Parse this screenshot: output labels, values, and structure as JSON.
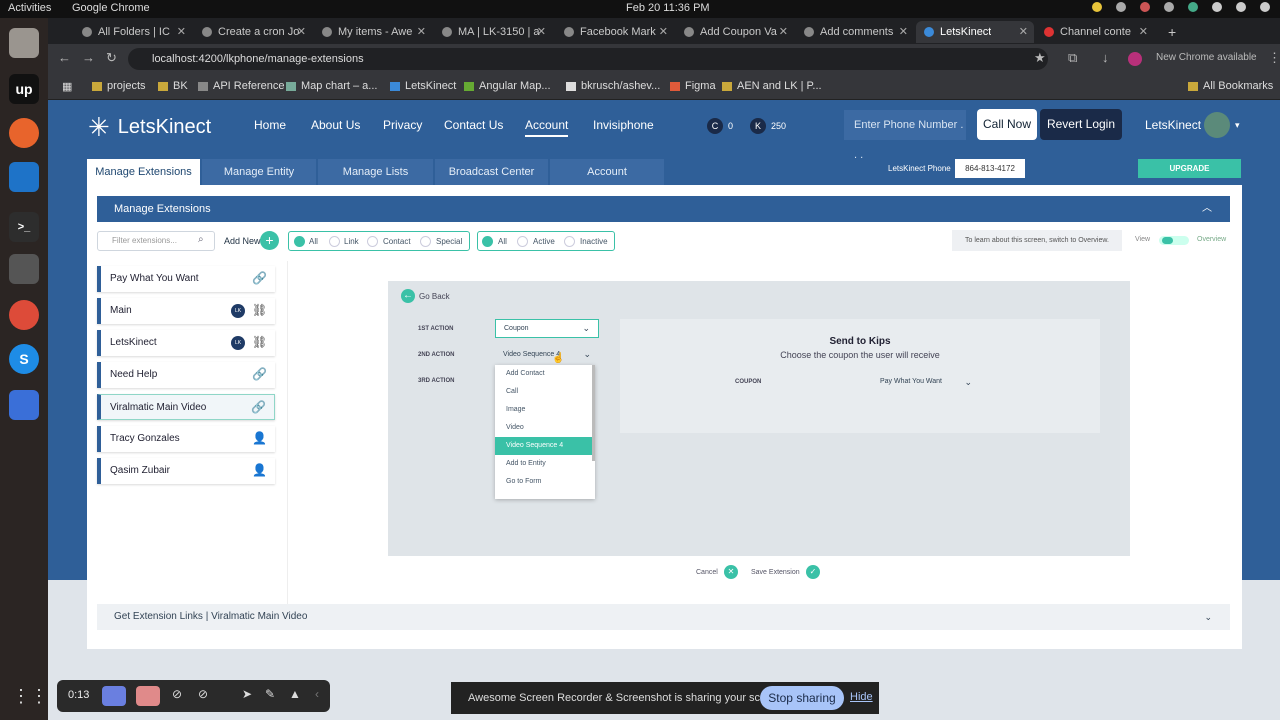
{
  "os": {
    "activities": "Activities",
    "app_name": "Google Chrome",
    "clock": "Feb 20  11:36 PM"
  },
  "browser": {
    "tabs": [
      {
        "label": "All Folders | IC"
      },
      {
        "label": "Create a cron Jo"
      },
      {
        "label": "My items - Awe"
      },
      {
        "label": "MA | LK-3150 | a"
      },
      {
        "label": "Facebook Mark"
      },
      {
        "label": "Add Coupon Va"
      },
      {
        "label": "Add comments"
      },
      {
        "label": "LetsKinect"
      },
      {
        "label": "Channel conte"
      }
    ],
    "url": "localhost:4200/lkphone/manage-extensions",
    "profile_label": "New Chrome available",
    "bookmarks": [
      "projects",
      "BK",
      "API Reference",
      "Map chart – a...",
      "LetsKinect",
      "Angular Map...",
      "bkrusch/ashev...",
      "Figma",
      "AEN and LK | P..."
    ],
    "all_bookmarks": "All Bookmarks"
  },
  "header": {
    "logo": "LetsKinect",
    "nav": [
      "Home",
      "About Us",
      "Privacy",
      "Contact Us",
      "Account",
      "Invisiphone"
    ],
    "counter_c_label": "C",
    "counter_c": "0",
    "counter_k_label": "K",
    "counter_k": "250",
    "phone_placeholder": "Enter Phone Number . . .",
    "call_now": "Call Now",
    "revert_login": "Revert Login",
    "user_name": "LetsKinect"
  },
  "subtabs": [
    "Manage Extensions",
    "Manage Entity",
    "Manage Lists",
    "Broadcast Center",
    "Account"
  ],
  "lk_phone_label": "LetsKinect Phone",
  "lk_phone_value": "864-813-4172",
  "upgrade": "UPGRADE",
  "section_title": "Manage Extensions",
  "filter": {
    "placeholder": "Filter extensions...",
    "add_new": "Add New",
    "types": [
      "All",
      "Link",
      "Contact",
      "Special"
    ],
    "states": [
      "All",
      "Active",
      "Inactive"
    ],
    "hint": "To learn about this screen, switch to Overview.",
    "view": "View",
    "overview": "Overview"
  },
  "extensions": [
    {
      "label": "Pay What You Want",
      "icon": "link-icon"
    },
    {
      "label": "Main",
      "icon": "hierarchy-icon",
      "badge": "LK"
    },
    {
      "label": "LetsKinect",
      "icon": "hierarchy-icon",
      "badge": "LK"
    },
    {
      "label": "Need Help",
      "icon": "link-icon"
    },
    {
      "label": "Viralmatic Main Video",
      "icon": "link-icon"
    },
    {
      "label": "Tracy Gonzales",
      "icon": "person-icon"
    },
    {
      "label": "Qasim Zubair",
      "icon": "person-icon"
    }
  ],
  "editor": {
    "go_back": "Go Back",
    "action1_label": "1ST ACTION",
    "action2_label": "2ND ACTION",
    "action3_label": "3RD ACTION",
    "action1_value": "Coupon",
    "action2_value": "Video Sequence 4",
    "dropdown_options": [
      "Add Contact",
      "Call",
      "Image",
      "Video",
      "Video Sequence 4",
      "Add to Entity",
      "Go to Form"
    ],
    "dropdown_selected": "Video Sequence 4",
    "send_title": "Send to Kips",
    "send_sub": "Choose the coupon the user will receive",
    "coupon_label": "COUPON",
    "coupon_value": "Pay What You Want",
    "cancel": "Cancel",
    "save": "Save Extension"
  },
  "links_section": "Get Extension Links | Viralmatic Main Video",
  "recorder": {
    "time": "0:13"
  },
  "share_bar": {
    "message": "Awesome Screen Recorder & Screenshot is sharing your screen.",
    "stop": "Stop sharing",
    "hide": "Hide"
  }
}
